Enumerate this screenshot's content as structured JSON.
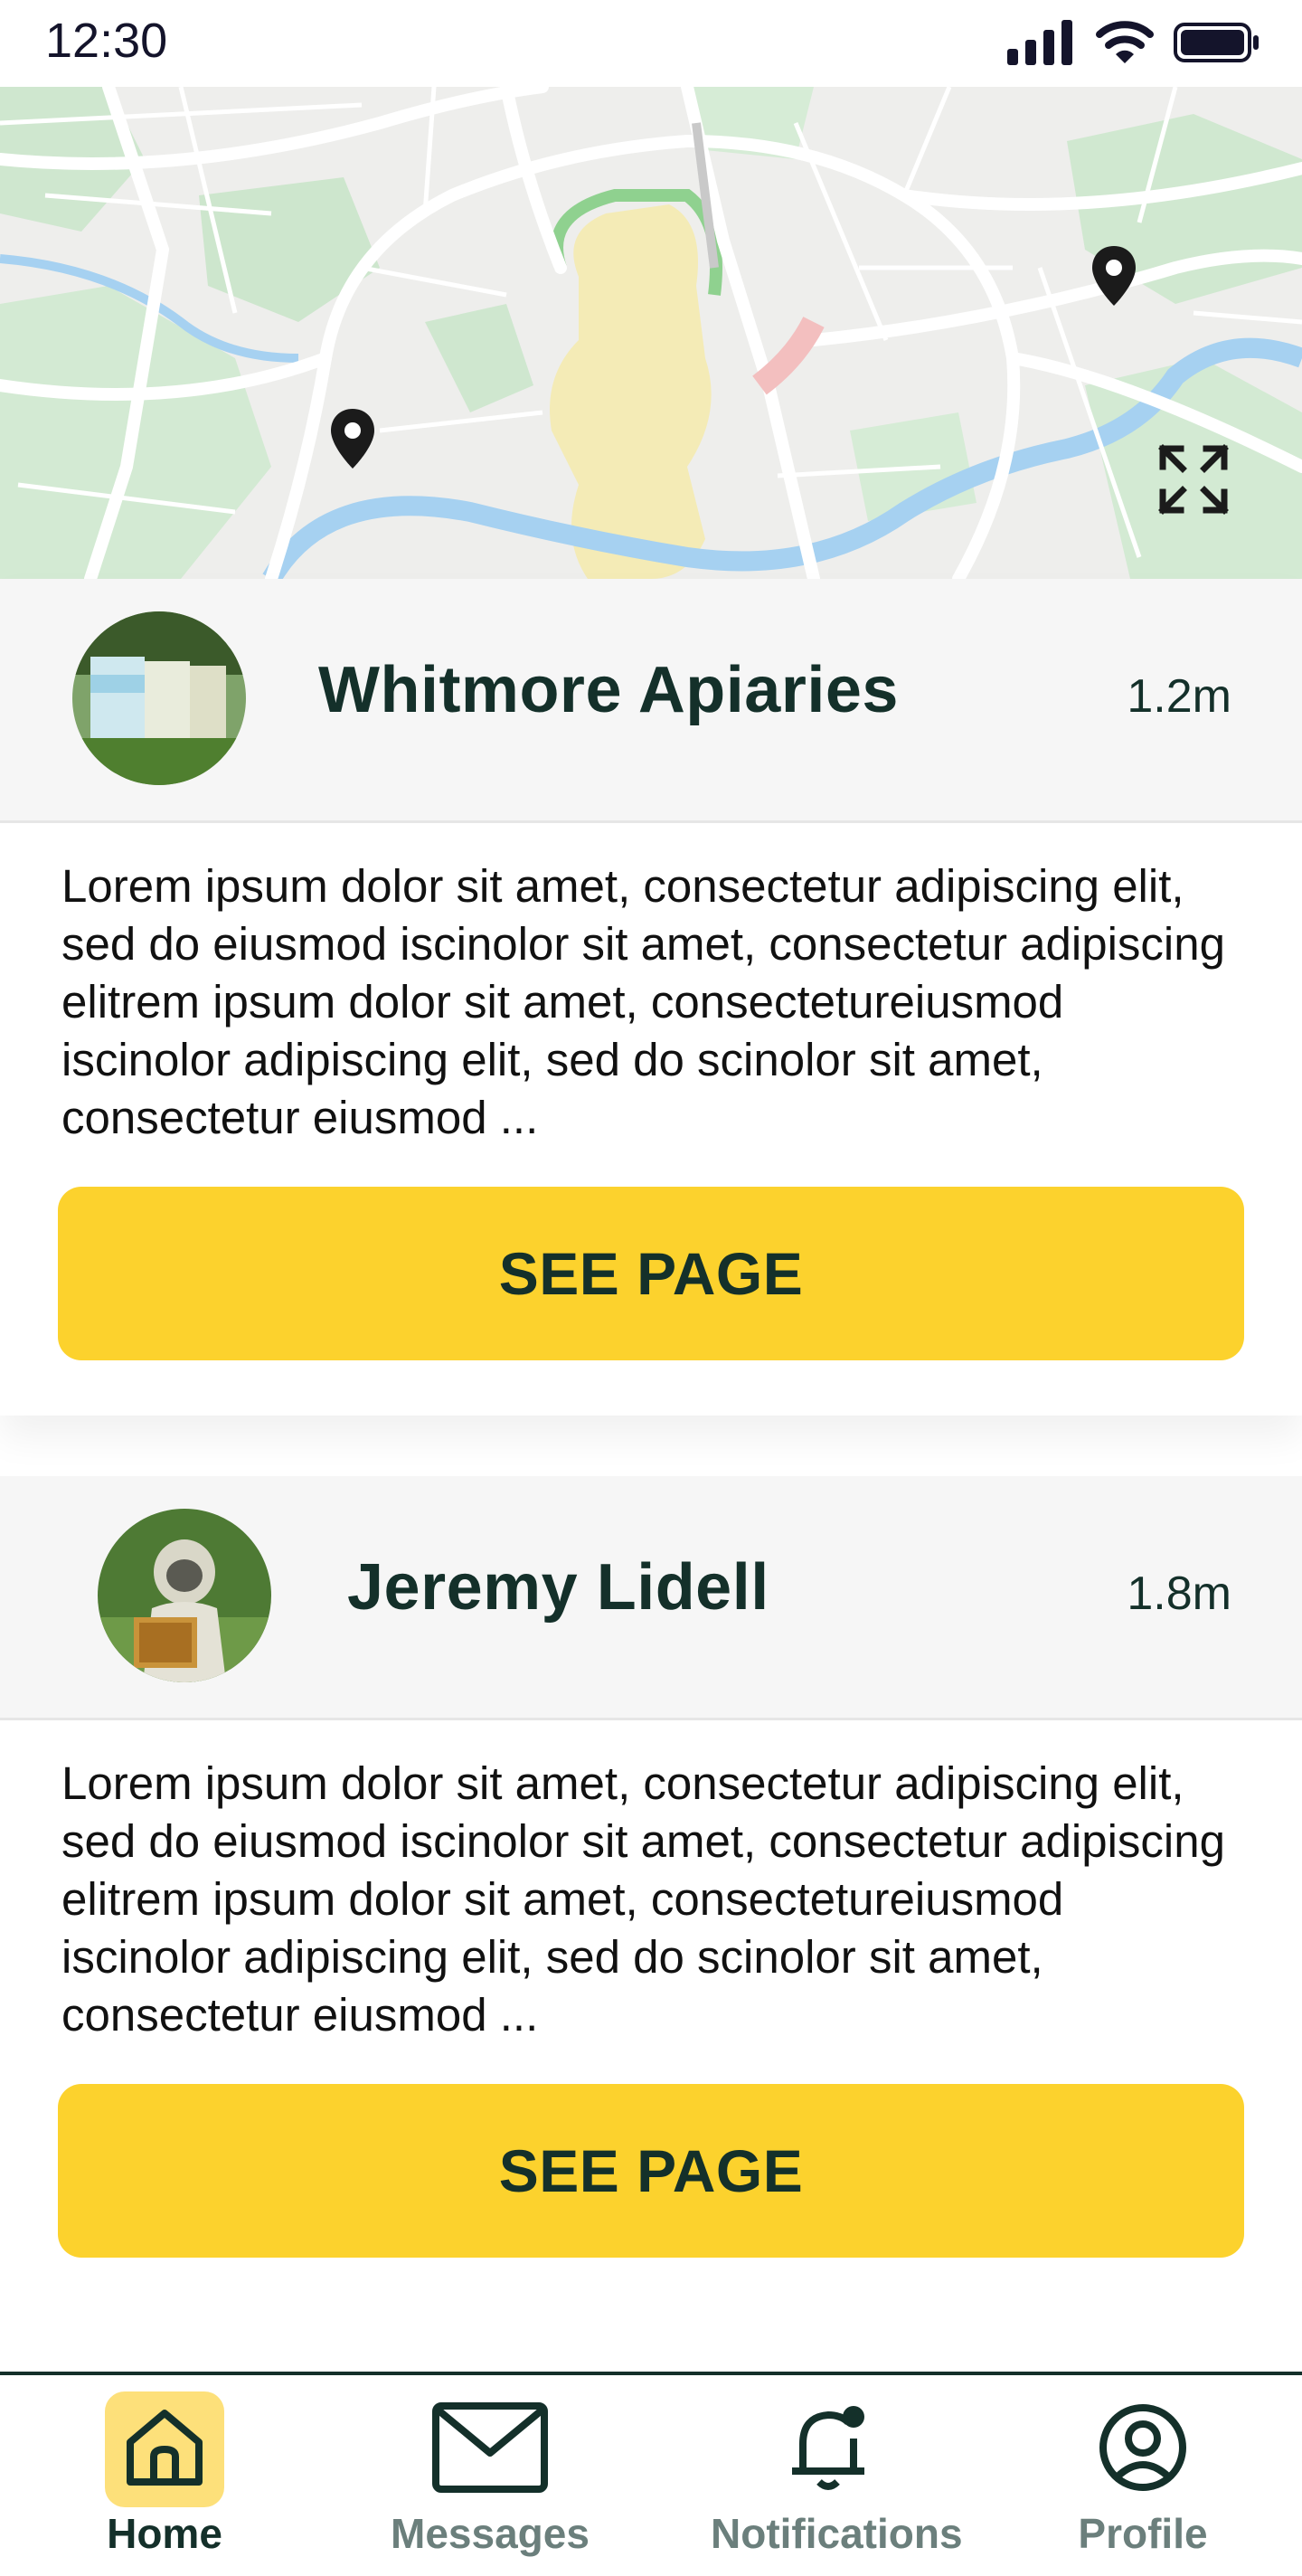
{
  "status_bar": {
    "time": "12:30"
  },
  "map": {
    "icons": [
      "location-pin-icon",
      "location-pin-icon",
      "expand-icon"
    ]
  },
  "cards": [
    {
      "name": "Whitmore Apiaries",
      "distance": "1.2m",
      "description": "Lorem ipsum dolor sit amet, consectetur adipiscing elit, sed do eiusmod iscinolor sit amet, consectetur adipiscing elitrem ipsum dolor sit amet, consectetureiusmod iscinolor adipiscing elit, sed do scinolor sit amet, consectetur eiusmod ...",
      "button_label": "SEE PAGE"
    },
    {
      "name": "Jeremy Lidell",
      "distance": "1.8m",
      "description": "Lorem ipsum dolor sit amet, consectetur adipiscing elit, sed do eiusmod iscinolor sit amet, consectetur adipiscing elitrem ipsum dolor sit amet, consectetureiusmod iscinolor adipiscing elit, sed do scinolor sit amet, consectetur eiusmod ...",
      "button_label": "SEE PAGE"
    }
  ],
  "nav": {
    "items": [
      {
        "label": "Home",
        "icon": "home-icon",
        "active": true
      },
      {
        "label": "Messages",
        "icon": "envelope-icon",
        "active": false
      },
      {
        "label": "Notifications",
        "icon": "bell-icon",
        "active": false
      },
      {
        "label": "Profile",
        "icon": "user-icon",
        "active": false
      }
    ]
  },
  "colors": {
    "accent": "#fcd22d",
    "text": "#14302a",
    "nav_active_bg": "#fde07a",
    "nav_inactive": "#6b7f7c"
  }
}
